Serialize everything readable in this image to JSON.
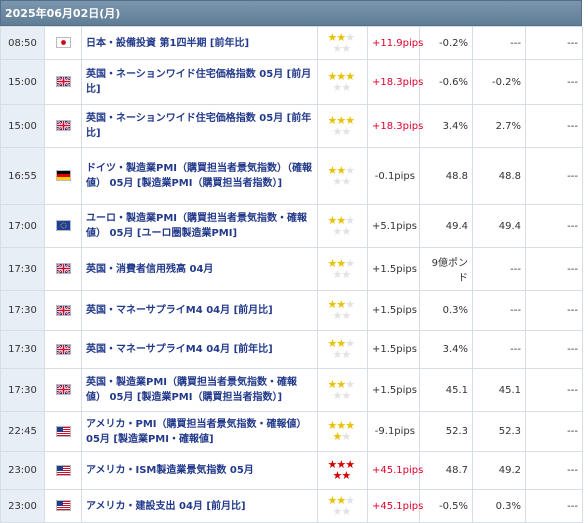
{
  "header": {
    "date": "2025年06月02日(月)"
  },
  "colors": {
    "header_bg": "#6b88a1",
    "time_bg": "#e8eef5",
    "positive": "#e0002a",
    "name": "#233a8b"
  },
  "rows": [
    {
      "time": "08:50",
      "flag": "japan-flag-icon",
      "name": "日本・設備投資 第1四半期 [前年比]",
      "stars": [
        "y",
        "y",
        "g",
        "g",
        "g"
      ],
      "pips": "+11.9pips",
      "pips_sign": "pos",
      "actual": "-0.2%",
      "forecast": "---",
      "prev": "---"
    },
    {
      "time": "15:00",
      "flag": "uk-flag-icon",
      "name": "英国・ネーションワイド住宅価格指数 05月 [前月比]",
      "stars": [
        "y",
        "y",
        "y",
        "g",
        "g"
      ],
      "pips": "+18.3pips",
      "pips_sign": "pos",
      "actual": "-0.6%",
      "forecast": "-0.2%",
      "prev": "---"
    },
    {
      "time": "15:00",
      "flag": "uk-flag-icon",
      "name": "英国・ネーションワイド住宅価格指数 05月 [前年比]",
      "stars": [
        "y",
        "y",
        "y",
        "g",
        "g"
      ],
      "pips": "+18.3pips",
      "pips_sign": "pos",
      "actual": "3.4%",
      "forecast": "2.7%",
      "prev": "---"
    },
    {
      "time": "16:55",
      "flag": "germany-flag-icon",
      "name": "ドイツ・製造業PMI（購買担当者景気指数）（確報値） 05月 [製造業PMI（購買担当者指数）]",
      "stars": [
        "y",
        "y",
        "g",
        "g",
        "g"
      ],
      "pips": "-0.1pips",
      "pips_sign": "neg",
      "actual": "48.8",
      "forecast": "48.8",
      "prev": "---"
    },
    {
      "time": "17:00",
      "flag": "eu-flag-icon",
      "name": "ユーロ・製造業PMI（購買担当者景気指数・確報値） 05月 [ユーロ圏製造業PMI]",
      "stars": [
        "y",
        "y",
        "g",
        "g",
        "g"
      ],
      "pips": "+5.1pips",
      "pips_sign": "neg",
      "actual": "49.4",
      "forecast": "49.4",
      "prev": "---"
    },
    {
      "time": "17:30",
      "flag": "uk-flag-icon",
      "name": "英国・消費者信用残高 04月",
      "stars": [
        "y",
        "y",
        "g",
        "g",
        "g"
      ],
      "pips": "+1.5pips",
      "pips_sign": "neg",
      "actual": "9億ポンド",
      "forecast": "---",
      "prev": "---"
    },
    {
      "time": "17:30",
      "flag": "uk-flag-icon",
      "name": "英国・マネーサプライM4 04月 [前月比]",
      "stars": [
        "y",
        "y",
        "g",
        "g",
        "g"
      ],
      "pips": "+1.5pips",
      "pips_sign": "neg",
      "actual": "0.3%",
      "forecast": "---",
      "prev": "---"
    },
    {
      "time": "17:30",
      "flag": "uk-flag-icon",
      "name": "英国・マネーサプライM4 04月 [前年比]",
      "stars": [
        "y",
        "y",
        "g",
        "g",
        "g"
      ],
      "pips": "+1.5pips",
      "pips_sign": "neg",
      "actual": "3.4%",
      "forecast": "---",
      "prev": "---"
    },
    {
      "time": "17:30",
      "flag": "uk-flag-icon",
      "name": "英国・製造業PMI（購買担当者景気指数・確報値） 05月 [製造業PMI（購買担当者指数）]",
      "stars": [
        "y",
        "y",
        "g",
        "g",
        "g"
      ],
      "pips": "+1.5pips",
      "pips_sign": "neg",
      "actual": "45.1",
      "forecast": "45.1",
      "prev": "---"
    },
    {
      "time": "22:45",
      "flag": "us-flag-icon",
      "name": "アメリカ・PMI（購買担当者景気指数・確報値） 05月 [製造業PMI・確報値]",
      "stars": [
        "y",
        "y",
        "y",
        "y",
        "g"
      ],
      "pips": "-9.1pips",
      "pips_sign": "neg",
      "actual": "52.3",
      "forecast": "52.3",
      "prev": "---"
    },
    {
      "time": "23:00",
      "flag": "us-flag-icon",
      "name": "アメリカ・ISM製造業景気指数 05月",
      "stars": [
        "r",
        "r",
        "r",
        "r",
        "r"
      ],
      "pips": "+45.1pips",
      "pips_sign": "pos",
      "actual": "48.7",
      "forecast": "49.2",
      "prev": "---"
    },
    {
      "time": "23:00",
      "flag": "us-flag-icon",
      "name": "アメリカ・建設支出 04月 [前月比]",
      "stars": [
        "y",
        "y",
        "g",
        "g",
        "g"
      ],
      "pips": "+45.1pips",
      "pips_sign": "pos",
      "actual": "-0.5%",
      "forecast": "0.3%",
      "prev": "---"
    }
  ]
}
